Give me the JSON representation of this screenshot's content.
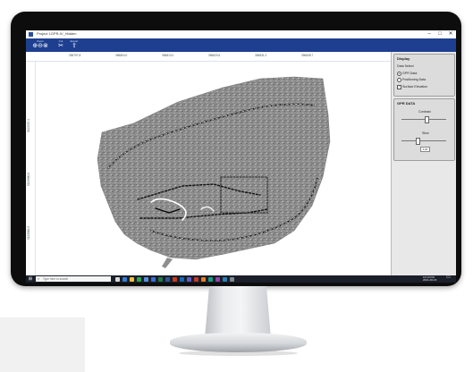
{
  "window": {
    "title": "Project 1GPR-IV_Hidden",
    "controls": [
      "–",
      "□",
      "✕"
    ]
  },
  "ribbon": {
    "groups": [
      {
        "label": "Zoom",
        "icons": [
          "zoom-in-icon",
          "zoom-out-icon",
          "zoom-fit-icon"
        ]
      },
      {
        "label": "Cut",
        "icons": [
          "scissors-icon"
        ]
      },
      {
        "label": "Export",
        "icons": [
          "export-icon"
        ]
      }
    ],
    "background": "#1e3f8f"
  },
  "axes": {
    "x_ticks": [
      "396797.8",
      "396804.0",
      "396813.0",
      "396820.6",
      "396831.2",
      "396838.7"
    ],
    "y_ticks": [
      "5129907.4",
      "5129880.0",
      "5129860.3"
    ]
  },
  "panel": {
    "display": {
      "title": "Display",
      "data_select_label": "Data Select",
      "options": [
        {
          "label": "GPR Data",
          "selected": true
        },
        {
          "label": "Positioning Data",
          "selected": false
        }
      ],
      "surface_label": "Surface Elevation",
      "surface_checked": true
    },
    "gpr": {
      "title": "GPR DATA",
      "contrast_label": "Contrast",
      "contrast_level": 0.55,
      "slice_label": "Slice",
      "slice_level": 0.35,
      "slice_value": "0.20"
    }
  },
  "taskbar": {
    "search_placeholder": "Type here to search",
    "time": "12:10 PM",
    "date": "2021-06-15",
    "icons": [
      "task-view-icon",
      "edge-icon",
      "explorer-icon",
      "chrome-icon",
      "store-icon",
      "mail-icon",
      "excel-icon",
      "word-icon",
      "powerpoint-icon",
      "outlook-icon",
      "teams-icon",
      "app1-icon",
      "app2-icon",
      "app3-icon",
      "app4-icon",
      "app5-icon",
      "app6-icon"
    ]
  },
  "colors": {
    "accent": "#1e3f8f",
    "taskbar": "#1b1f2a",
    "panel": "#e8e8e8",
    "map": "#8a8a8a"
  }
}
